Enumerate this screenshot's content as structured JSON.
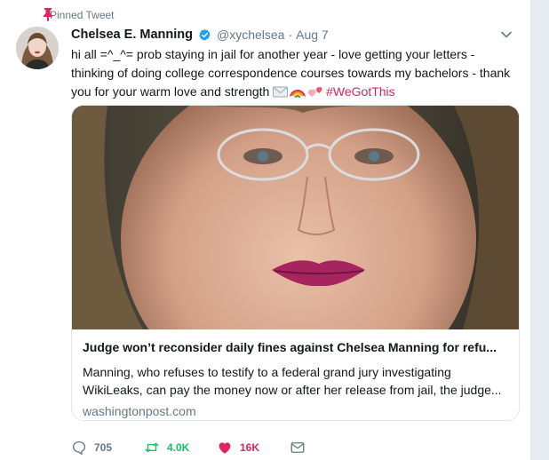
{
  "pinned": {
    "label": "Pinned Tweet"
  },
  "tweet": {
    "name": "Chelsea E. Manning",
    "handle": "@xychelsea",
    "separator": "·",
    "date": "Aug 7",
    "text": "hi all =^_^= prob staying in jail for another year - love getting your letters - thinking of doing college correspondence courses towards my bachelors - thank you for your warm love and strength",
    "emojis": [
      "envelope-emoji",
      "rainbow-emoji",
      "two-hearts-emoji"
    ],
    "hashtag": "#WeGotThis"
  },
  "card": {
    "title": "Judge won’t reconsider daily fines against Chelsea Manning for refu...",
    "description_line1": "Manning, who refuses to testify to a federal grand jury investigating",
    "description_line2": "WikiLeaks, can pay the money now or after her release from jail, the judge...",
    "domain": "washingtonpost.com"
  },
  "actions": {
    "replies": "705",
    "retweets": "4.0K",
    "likes": "16K"
  },
  "colors": {
    "accent_like": "#e0245e",
    "accent_retweet": "#17bf63",
    "muted": "#657786",
    "verified": "#1da1f2"
  }
}
